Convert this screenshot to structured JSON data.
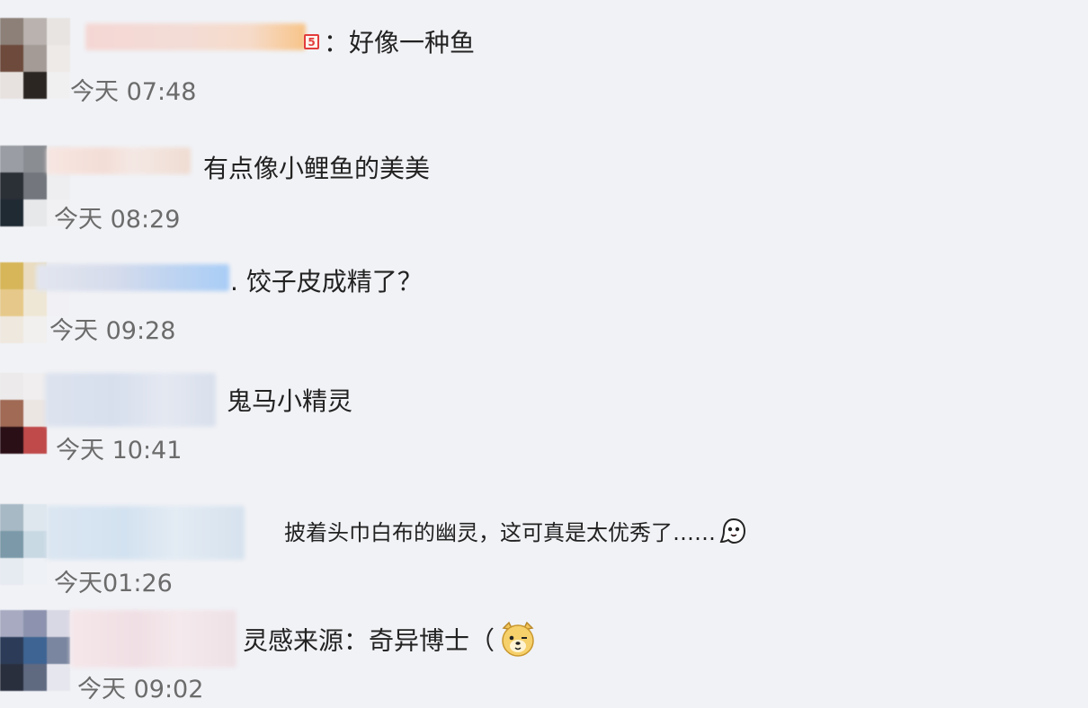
{
  "comments": [
    {
      "text": "：好像一种鱼",
      "time": "今天 07:48"
    },
    {
      "text": "有点像小鲤鱼的美美",
      "time": "今天 08:29"
    },
    {
      "text": ". 饺子皮成精了？",
      "time": "今天 09:28"
    },
    {
      "text": "鬼马小精灵",
      "time": "今天 10:41"
    },
    {
      "text": "披着头巾白布的幽灵，这可真是太优秀了……",
      "time": "今天01:26",
      "emoji": "ghost-emoji"
    },
    {
      "text": "灵感来源：奇异博士（",
      "time": "今天 09:02",
      "emoji": "dog-face-emoji"
    }
  ],
  "badge": "5"
}
